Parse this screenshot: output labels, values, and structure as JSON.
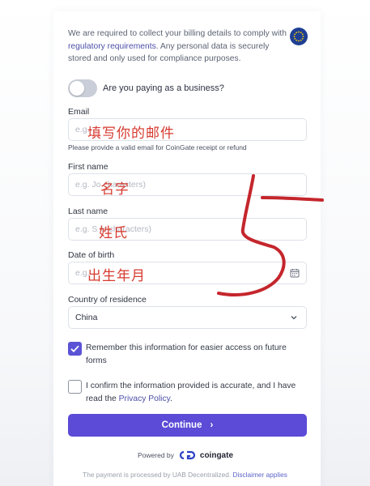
{
  "notice": {
    "before": "We are required to collect your billing details to comply with ",
    "link": "regulatory requirements",
    "after": ". Any personal data is securely stored and only used for compliance purposes."
  },
  "business_toggle": {
    "label": "Are you paying as a business?",
    "on": false
  },
  "email": {
    "label": "Email",
    "placeholder": "e.g.",
    "hint": "Please provide a valid email for CoinGate receipt or refund",
    "annotation": "填写你的邮件"
  },
  "first_name": {
    "label": "First name",
    "placeholder": "e.g. Jo        characters)",
    "annotation": "名字"
  },
  "last_name": {
    "label": "Last name",
    "placeholder": "e.g. S        in characters)",
    "annotation": "姓氏"
  },
  "dob": {
    "label": "Date of birth",
    "placeholder": "e.g.",
    "annotation": "出生年月"
  },
  "country": {
    "label": "Country of residence",
    "value": "China"
  },
  "remember": {
    "text": "Remember this information for easier access on future forms",
    "checked": true
  },
  "confirm": {
    "before": "I confirm the information provided is accurate, and I have read the ",
    "link": "Privacy Policy",
    "after": ".",
    "checked": false
  },
  "continue_label": "Continue",
  "powered_by": "Powered by",
  "brand": "coingate",
  "footer": {
    "text": "The payment is processed by UAB Decentralized. ",
    "link": "Disclaimer applies"
  },
  "colors": {
    "primary": "#5b4bd6",
    "annotation_red": "#d63a2f",
    "link": "#4c4fa8"
  },
  "icons": [
    "eu-flag-icon",
    "calendar-icon",
    "chevron-down-icon",
    "check-icon",
    "arrow-right-icon",
    "coingate-logo-icon"
  ]
}
